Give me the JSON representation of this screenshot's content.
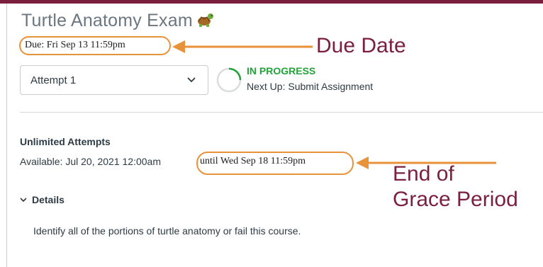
{
  "assignment": {
    "title": "Turtle Anatomy Exam",
    "due": "Due: Fri Sep 13 11:59pm"
  },
  "callouts": {
    "due_date": "Due Date",
    "grace_line1": "End of",
    "grace_line2": "Grace Period"
  },
  "attempt_select": {
    "selected": "Attempt 1"
  },
  "status": {
    "label": "IN PROGRESS",
    "next": "Next Up: Submit Assignment"
  },
  "availability": {
    "attempts": "Unlimited Attempts",
    "available": "Available: Jul 20, 2021 12:00am",
    "until": "until Wed Sep 18 11:59pm"
  },
  "details": {
    "toggle_label": "Details",
    "description": "Identify all of the portions of turtle anatomy or fail this course."
  },
  "icons": {
    "title_icon": "turtle-icon",
    "select_chevron": "chevron-down-icon",
    "details_chevron": "chevron-down-icon",
    "progress": "progress-ring-icon"
  },
  "colors": {
    "brand": "#7a1f3d",
    "highlight": "#e8923a",
    "status_green": "#22a338"
  }
}
